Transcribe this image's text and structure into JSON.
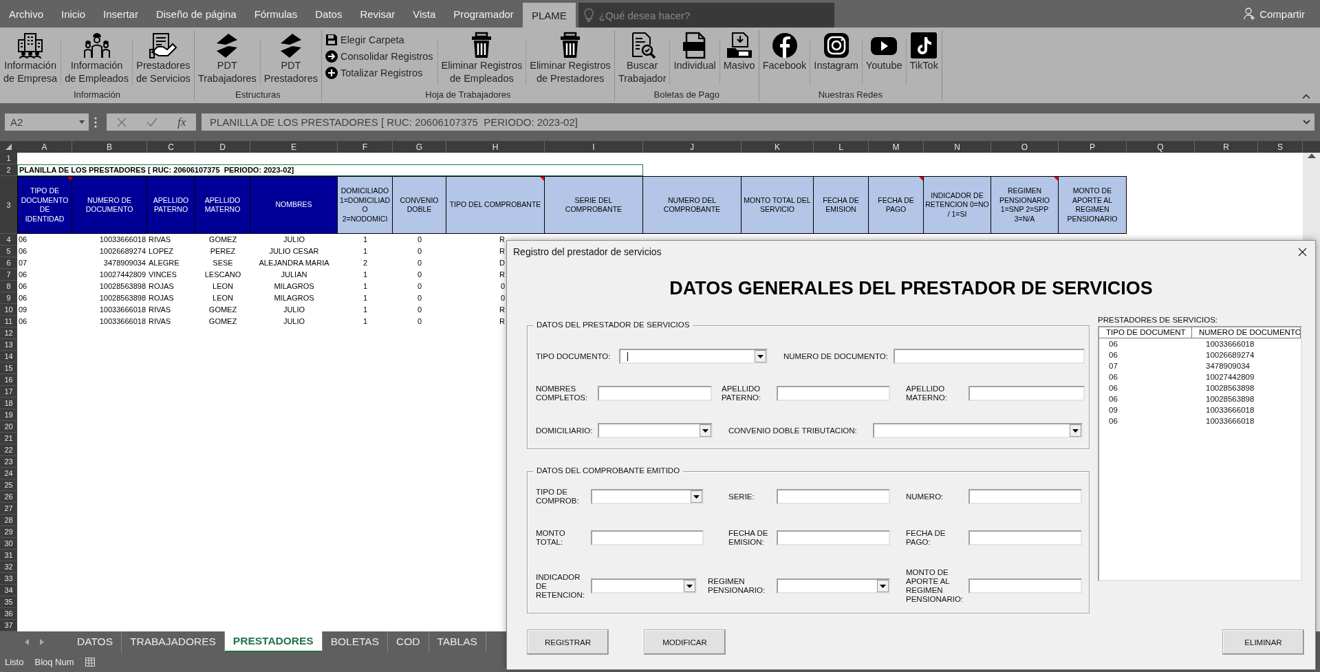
{
  "menu_tabs": [
    {
      "label": "Archivo",
      "selected": false
    },
    {
      "label": "Inicio",
      "selected": false
    },
    {
      "label": "Insertar",
      "selected": false
    },
    {
      "label": "Diseño de página",
      "selected": false
    },
    {
      "label": "Fórmulas",
      "selected": false
    },
    {
      "label": "Datos",
      "selected": false
    },
    {
      "label": "Revisar",
      "selected": false
    },
    {
      "label": "Vista",
      "selected": false
    },
    {
      "label": "Programador",
      "selected": false
    },
    {
      "label": "PLAME",
      "selected": true
    }
  ],
  "search": {
    "placeholder": "¿Qué desea hacer?"
  },
  "share_button": "Compartir",
  "ribbon": {
    "groups": [
      {
        "label": "Información",
        "buttons": [
          {
            "label_lines": [
              "Información",
              "de Empresa"
            ]
          },
          {
            "label_lines": [
              "Información",
              "de Empleados"
            ]
          },
          {
            "label_lines": [
              "Prestadores",
              "de Servicios"
            ]
          }
        ]
      },
      {
        "label": "Estructuras",
        "buttons": [
          {
            "label_lines": [
              "PDT",
              "Trabajadores"
            ]
          },
          {
            "label_lines": [
              "PDT",
              "Prestadores"
            ]
          }
        ]
      },
      {
        "label": "Hoja de Trabajadores",
        "small_buttons": [
          "Elegir Carpeta",
          "Consolidar Registros",
          "Totalizar Registros"
        ],
        "buttons": [
          {
            "label_lines": [
              "Eliminar Registros",
              "de Empleados"
            ]
          },
          {
            "label_lines": [
              "Eliminar Registros",
              "de Prestadores"
            ]
          }
        ]
      },
      {
        "label": "Boletas de Pago",
        "buttons": [
          {
            "label_lines": [
              "Buscar",
              "Trabajador"
            ]
          },
          {
            "label_lines": [
              "Individual"
            ]
          },
          {
            "label_lines": [
              "Masivo"
            ]
          }
        ]
      },
      {
        "label": "Nuestras Redes",
        "buttons": [
          {
            "label_lines": [
              "Facebook"
            ]
          },
          {
            "label_lines": [
              "Instagram"
            ]
          },
          {
            "label_lines": [
              "Youtube"
            ]
          },
          {
            "label_lines": [
              "TikTok"
            ]
          }
        ]
      }
    ]
  },
  "formula_bar": {
    "name_box": "A2",
    "function_label": "fx",
    "formula": "PLANILLA DE LOS PRESTADORES [ RUC: 20606107375  PERIODO: 2023-02]"
  },
  "sheet": {
    "column_headers": [
      "A",
      "B",
      "C",
      "D",
      "E",
      "F",
      "G",
      "H",
      "I",
      "J",
      "K",
      "L",
      "M",
      "N",
      "O",
      "P",
      "Q",
      "R",
      "S"
    ],
    "row_numbers": [
      "1",
      "2",
      "3",
      "4",
      "5",
      "6",
      "7",
      "8",
      "9",
      "10",
      "11",
      "12",
      "13",
      "14",
      "15",
      "16",
      "17",
      "18",
      "19",
      "20",
      "21",
      "22",
      "23",
      "24",
      "25",
      "26",
      "27",
      "28",
      "29",
      "30",
      "31",
      "32",
      "33",
      "34",
      "35",
      "36",
      "37"
    ],
    "title_cell": {
      "text": "PLANILLA DE LOS PRESTADORES [ RUC: 20606107375  PERIODO: 2023-02]",
      "selected": true
    },
    "header_row": [
      {
        "text": "TIPO DE DOCUMENTO DE IDENTIDAD",
        "color": "#000099",
        "has_comment": true
      },
      {
        "text": "NUMERO DE DOCUMENTO",
        "color": "#000099",
        "has_comment": false
      },
      {
        "text": "APELLIDO PATERNO",
        "color": "#000099",
        "has_comment": false
      },
      {
        "text": "APELLIDO MATERNO",
        "color": "#000099",
        "has_comment": false
      },
      {
        "text": "NOMBRES",
        "color": "#000099",
        "has_comment": false
      },
      {
        "text": "DOMICILIADO 1=DOMICILIADO 2=NODOMICI",
        "color": "#b4c6e7",
        "has_comment": false
      },
      {
        "text": "CONVENIO DOBLE",
        "color": "#b4c6e7",
        "has_comment": false
      },
      {
        "text": "TIPO DEL COMPROBANTE",
        "color": "#b4c6e7",
        "has_comment": true
      },
      {
        "text": "SERIE DEL COMPROBANTE",
        "color": "#b4c6e7",
        "has_comment": false
      },
      {
        "text": "NUMERO DEL COMPROBANTE",
        "color": "#b4c6e7",
        "has_comment": false
      },
      {
        "text": "MONTO TOTAL DEL SERVICIO",
        "color": "#b4c6e7",
        "has_comment": false
      },
      {
        "text": "FECHA DE EMISION",
        "color": "#b4c6e7",
        "has_comment": false
      },
      {
        "text": "FECHA DE PAGO",
        "color": "#b4c6e7",
        "has_comment": true
      },
      {
        "text": "INDICADOR DE RETENCION 0=NO / 1=SI",
        "color": "#b4c6e7",
        "has_comment": false
      },
      {
        "text": "REGIMEN PENSIONARIO 1=SNP 2=SPP 3=N/A",
        "color": "#b4c6e7",
        "has_comment": true
      },
      {
        "text": "MONTO DE APORTE AL REGIMEN PENSIONARIO",
        "color": "#b4c6e7",
        "has_comment": false
      }
    ],
    "rows": [
      [
        "06",
        "10033666018",
        "RIVAS",
        "GOMEZ",
        "JULIO",
        "1",
        "0",
        "R"
      ],
      [
        "06",
        "10026689274",
        "LOPEZ",
        "PEREZ",
        "JULIO CESAR",
        "1",
        "0",
        "R"
      ],
      [
        "07",
        "3478909034",
        "ALEGRE",
        "SESE",
        "ALEJANDRA MARIA",
        "2",
        "0",
        "D"
      ],
      [
        "06",
        "10027442809",
        "VINCES",
        "LESCANO",
        "JULIAN",
        "1",
        "0",
        "R"
      ],
      [
        "06",
        "10028563898",
        "ROJAS",
        "LEON",
        "MILAGROS",
        "1",
        "0",
        "0"
      ],
      [
        "06",
        "10028563898",
        "ROJAS",
        "LEON",
        "MILAGROS",
        "1",
        "0",
        "0"
      ],
      [
        "09",
        "10033666018",
        "RIVAS",
        "GOMEZ",
        "JULIO",
        "1",
        "0",
        "R"
      ],
      [
        "06",
        "10033666018",
        "RIVAS",
        "GOMEZ",
        "JULIO",
        "1",
        "0",
        "R"
      ]
    ]
  },
  "sheet_tabs": [
    {
      "label": "DATOS",
      "selected": false
    },
    {
      "label": "TRABAJADORES",
      "selected": false
    },
    {
      "label": "PRESTADORES",
      "selected": true
    },
    {
      "label": "BOLETAS",
      "selected": false
    },
    {
      "label": "COD",
      "selected": false
    },
    {
      "label": "TABLAS",
      "selected": false
    }
  ],
  "status_bar": {
    "items": [
      "Listo",
      "Bloq Num"
    ]
  },
  "dialog": {
    "title": "Registro del prestador de servicios",
    "heading": "DATOS GENERALES DEL PRESTADOR DE SERVICIOS",
    "sections": [
      {
        "legend": "DATOS DEL PRESTADOR DE SERVICIOS",
        "rows": [
          [
            {
              "label_lines": [
                "TIPO DOCUMENTO:"
              ],
              "kind": "combo",
              "focused": true
            },
            {
              "label_lines": [
                "NUMERO DE DOCUMENTO:"
              ],
              "kind": "text",
              "focused": false
            }
          ],
          [
            {
              "label_lines": [
                "NOMBRES",
                "COMPLETOS:"
              ],
              "kind": "text",
              "focused": false
            },
            {
              "label_lines": [
                "APELLIDO",
                "PATERNO:"
              ],
              "kind": "text",
              "focused": false
            },
            {
              "label_lines": [
                "APELLIDO",
                "MATERNO:"
              ],
              "kind": "text",
              "focused": false
            }
          ],
          [
            {
              "label_lines": [
                "DOMICILIARIO:"
              ],
              "kind": "combo",
              "focused": false
            },
            {
              "label_lines": [
                "CONVENIO DOBLE TRIBUTACION:"
              ],
              "kind": "combo",
              "focused": false
            }
          ]
        ]
      },
      {
        "legend": "DATOS DEL COMPROBANTE EMITIDO",
        "rows": [
          [
            {
              "label_lines": [
                "TIPO DE",
                "COMPROB:"
              ],
              "kind": "combo",
              "focused": false
            },
            {
              "label_lines": [
                "SERIE:"
              ],
              "kind": "text",
              "focused": false
            },
            {
              "label_lines": [
                "NUMERO:"
              ],
              "kind": "text",
              "focused": false
            }
          ],
          [
            {
              "label_lines": [
                "MONTO",
                "TOTAL:"
              ],
              "kind": "text",
              "focused": false
            },
            {
              "label_lines": [
                "FECHA DE",
                "EMISION:"
              ],
              "kind": "text",
              "focused": false
            },
            {
              "label_lines": [
                "FECHA DE",
                "PAGO:"
              ],
              "kind": "text",
              "focused": false
            }
          ],
          [
            {
              "label_lines": [
                "INDICADOR",
                "DE",
                "RETENCION:"
              ],
              "kind": "combo",
              "focused": false
            },
            {
              "label_lines": [
                "REGIMEN",
                "PENSIONARIO:"
              ],
              "kind": "combo",
              "focused": false
            },
            {
              "label_lines": [
                "MONTO DE",
                "APORTE AL",
                "REGIMEN",
                "PENSIONARIO:"
              ],
              "kind": "text",
              "focused": false
            }
          ]
        ]
      }
    ],
    "list": {
      "label": "PRESTADORES DE SERVICIOS:",
      "columns": [
        "TIPO DE DOCUMENT",
        "NUMERO DE DOCUMENTO"
      ],
      "rows": [
        [
          "06",
          "10033666018"
        ],
        [
          "06",
          "10026689274"
        ],
        [
          "07",
          "3478909034"
        ],
        [
          "06",
          "10027442809"
        ],
        [
          "06",
          "10028563898"
        ],
        [
          "06",
          "10028563898"
        ],
        [
          "09",
          "10033666018"
        ],
        [
          "06",
          "10033666018"
        ]
      ]
    },
    "buttons": [
      "REGISTRAR",
      "MODIFICAR",
      "ELIMINAR"
    ]
  }
}
